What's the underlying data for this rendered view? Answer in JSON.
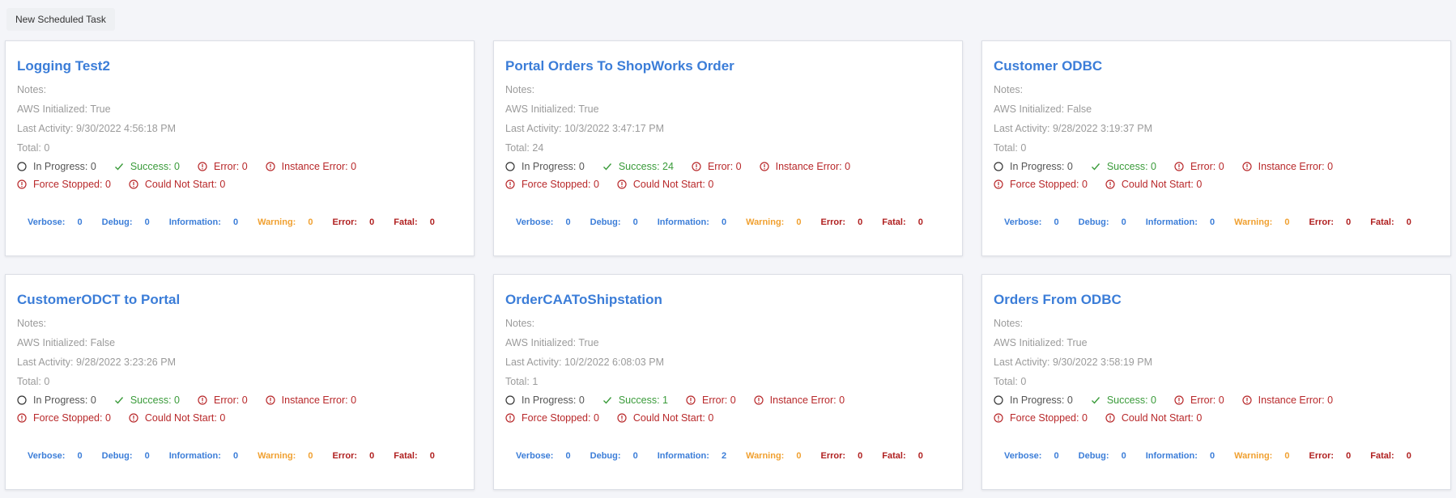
{
  "toolbar": {
    "new_task_label": "New Scheduled Task"
  },
  "labels": {
    "notes": "Notes:",
    "aws": "AWS Initialized:",
    "last_activity": "Last Activity:",
    "total": "Total:",
    "in_progress": "In Progress:",
    "success": "Success:",
    "error": "Error:",
    "instance_error": "Instance Error:",
    "force_stopped": "Force Stopped:",
    "could_not_start": "Could Not Start:",
    "verbose": "Verbose:",
    "debug": "Debug:",
    "information": "Information:",
    "warning": "Warning:",
    "log_error": "Error:",
    "fatal": "Fatal:"
  },
  "colors": {
    "title": "#3b7dd8",
    "success": "#3a9b3a",
    "error": "#b8282a",
    "warning": "#f0a030"
  },
  "tasks": [
    {
      "title": "Logging Test2",
      "notes": "",
      "aws": "True",
      "last_activity": "9/30/2022 4:56:18 PM",
      "total": "0",
      "in_progress": "0",
      "success": "0",
      "error": "0",
      "instance_error": "0",
      "force_stopped": "0",
      "could_not_start": "0",
      "verbose": "0",
      "debug": "0",
      "information": "0",
      "warning": "0",
      "log_error": "0",
      "fatal": "0"
    },
    {
      "title": "Portal Orders To ShopWorks Order",
      "notes": "",
      "aws": "True",
      "last_activity": "10/3/2022 3:47:17 PM",
      "total": "24",
      "in_progress": "0",
      "success": "24",
      "error": "0",
      "instance_error": "0",
      "force_stopped": "0",
      "could_not_start": "0",
      "verbose": "0",
      "debug": "0",
      "information": "0",
      "warning": "0",
      "log_error": "0",
      "fatal": "0"
    },
    {
      "title": "Customer ODBC",
      "notes": "",
      "aws": "False",
      "last_activity": "9/28/2022 3:19:37 PM",
      "total": "0",
      "in_progress": "0",
      "success": "0",
      "error": "0",
      "instance_error": "0",
      "force_stopped": "0",
      "could_not_start": "0",
      "verbose": "0",
      "debug": "0",
      "information": "0",
      "warning": "0",
      "log_error": "0",
      "fatal": "0"
    },
    {
      "title": "CustomerODCT to Portal",
      "notes": "",
      "aws": "False",
      "last_activity": "9/28/2022 3:23:26 PM",
      "total": "0",
      "in_progress": "0",
      "success": "0",
      "error": "0",
      "instance_error": "0",
      "force_stopped": "0",
      "could_not_start": "0",
      "verbose": "0",
      "debug": "0",
      "information": "0",
      "warning": "0",
      "log_error": "0",
      "fatal": "0"
    },
    {
      "title": "OrderCAAToShipstation",
      "notes": "",
      "aws": "True",
      "last_activity": "10/2/2022 6:08:03 PM",
      "total": "1",
      "in_progress": "0",
      "success": "1",
      "error": "0",
      "instance_error": "0",
      "force_stopped": "0",
      "could_not_start": "0",
      "verbose": "0",
      "debug": "0",
      "information": "2",
      "warning": "0",
      "log_error": "0",
      "fatal": "0"
    },
    {
      "title": "Orders From ODBC",
      "notes": "",
      "aws": "True",
      "last_activity": "9/30/2022 3:58:19 PM",
      "total": "0",
      "in_progress": "0",
      "success": "0",
      "error": "0",
      "instance_error": "0",
      "force_stopped": "0",
      "could_not_start": "0",
      "verbose": "0",
      "debug": "0",
      "information": "0",
      "warning": "0",
      "log_error": "0",
      "fatal": "0"
    }
  ]
}
